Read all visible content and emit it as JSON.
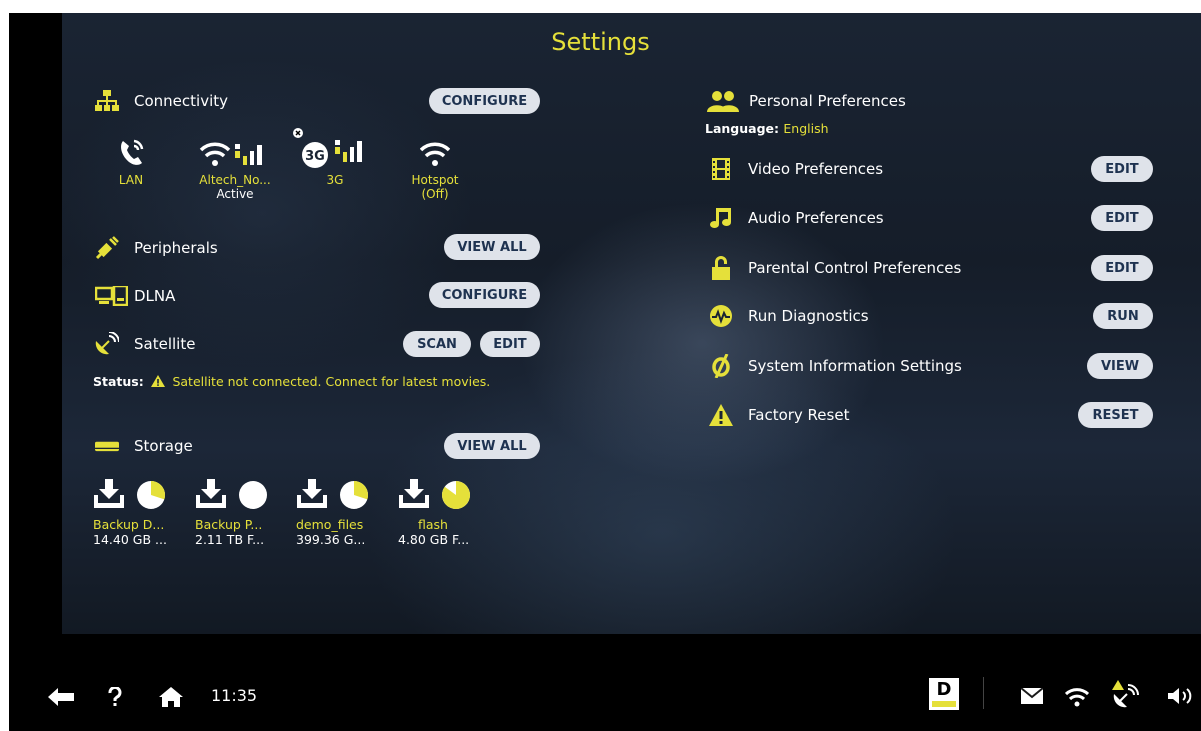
{
  "title": "Settings",
  "left": {
    "connectivity": {
      "label": "Connectivity",
      "button": "CONFIGURE"
    },
    "networks": [
      {
        "label": "LAN",
        "sub": ""
      },
      {
        "label": "Altech_No...",
        "sub": "Active"
      },
      {
        "label": "3G",
        "sub": ""
      },
      {
        "label": "Hotspot",
        "sub": "(Off)"
      }
    ],
    "peripherals": {
      "label": "Peripherals",
      "button": "VIEW ALL"
    },
    "dlna": {
      "label": "DLNA",
      "button": "CONFIGURE"
    },
    "satellite": {
      "label": "Satellite",
      "scan": "SCAN",
      "edit": "EDIT",
      "status_label": "Status:",
      "status_text": "Satellite not connected. Connect for latest movies."
    },
    "storage": {
      "label": "Storage",
      "button": "VIEW ALL",
      "items": [
        {
          "name": "Backup D...",
          "size": "14.40 GB ...",
          "used": 0.3
        },
        {
          "name": "Backup P...",
          "size": "2.11 TB F...",
          "used": 0.0
        },
        {
          "name": "demo_files",
          "size": "399.36 G...",
          "used": 0.3
        },
        {
          "name": "flash",
          "size": "4.80 GB F...",
          "used": 0.85
        }
      ]
    }
  },
  "right": {
    "personal": {
      "label": "Personal Preferences",
      "language_label": "Language:",
      "language": "English"
    },
    "items": [
      {
        "label": "Video Preferences",
        "button": "EDIT"
      },
      {
        "label": "Audio Preferences",
        "button": "EDIT"
      },
      {
        "label": "Parental Control Preferences",
        "button": "EDIT"
      },
      {
        "label": "Run Diagnostics",
        "button": "RUN"
      },
      {
        "label": "System Information Settings",
        "button": "VIEW"
      },
      {
        "label": "Factory Reset",
        "button": "RESET"
      }
    ]
  },
  "bottom": {
    "time": "11:35",
    "brand": "D"
  },
  "colors": {
    "accent": "#e5e03a",
    "button_bg": "#dfe3ea",
    "button_text": "#1e3250"
  }
}
